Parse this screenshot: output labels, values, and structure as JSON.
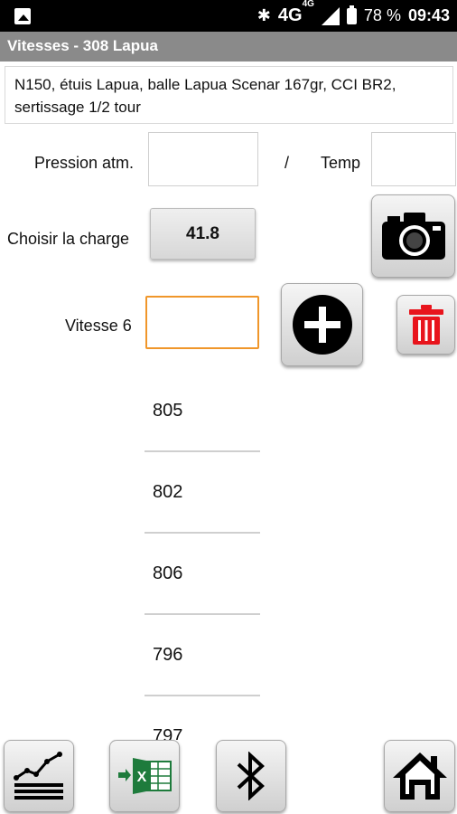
{
  "status_bar": {
    "network": "4G",
    "network_sup": "4G",
    "battery": "78 %",
    "time": "09:43"
  },
  "title": "Vitesses - 308 Lapua",
  "description": "N150, étuis Lapua, balle Lapua Scenar 167gr, CCI BR2, sertissage 1/2 tour",
  "form": {
    "pressure_label": "Pression atm.",
    "pressure_value": "",
    "separator": "/",
    "temp_label": "Temp",
    "temp_value": "",
    "charge_label": "Choisir la charge",
    "charge_value": "41.8",
    "velocity_label": "Vitesse 6",
    "velocity_value": ""
  },
  "velocities": [
    "805",
    "802",
    "806",
    "796",
    "797"
  ],
  "icons": {
    "camera": "camera-icon",
    "add": "plus-circle-icon",
    "delete": "trash-icon",
    "chart": "chart-icon",
    "excel": "excel-export-icon",
    "bluetooth": "bluetooth-icon",
    "home": "home-icon"
  },
  "colors": {
    "title_bar": "#8a8a8a",
    "active_input": "#f0962a",
    "trash": "#e8141c",
    "excel_green": "#1e7b3c"
  }
}
